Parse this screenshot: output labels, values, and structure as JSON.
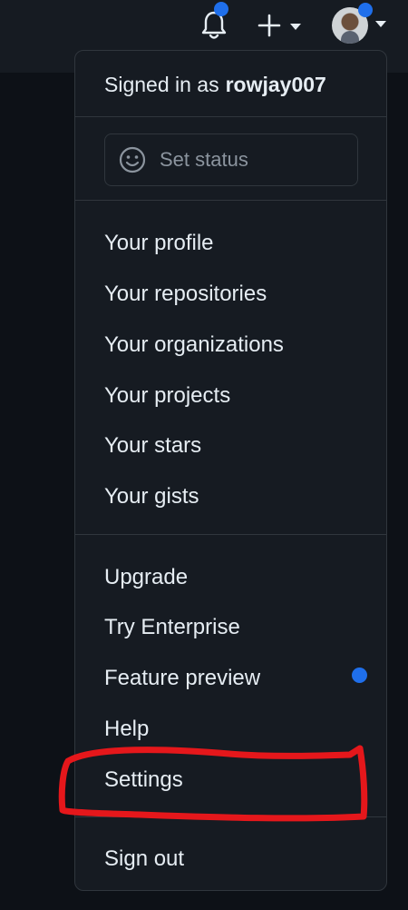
{
  "header": {
    "signed_in_prefix": "Signed in as",
    "username": "rowjay007"
  },
  "status": {
    "label": "Set status"
  },
  "menu": {
    "profile_items": [
      "Your profile",
      "Your repositories",
      "Your organizations",
      "Your projects",
      "Your stars",
      "Your gists"
    ],
    "more_items": [
      "Upgrade",
      "Try Enterprise",
      "Feature preview",
      "Help",
      "Settings"
    ],
    "sign_out": "Sign out"
  },
  "topbar_icons": {
    "notifications": "bell-icon",
    "create": "plus-icon",
    "profile": "avatar-icon"
  },
  "colors": {
    "background": "#0d1117",
    "surface": "#161b22",
    "border": "#30363d",
    "accent_blue": "#1f6feb",
    "annotation_red": "#e5171b"
  }
}
